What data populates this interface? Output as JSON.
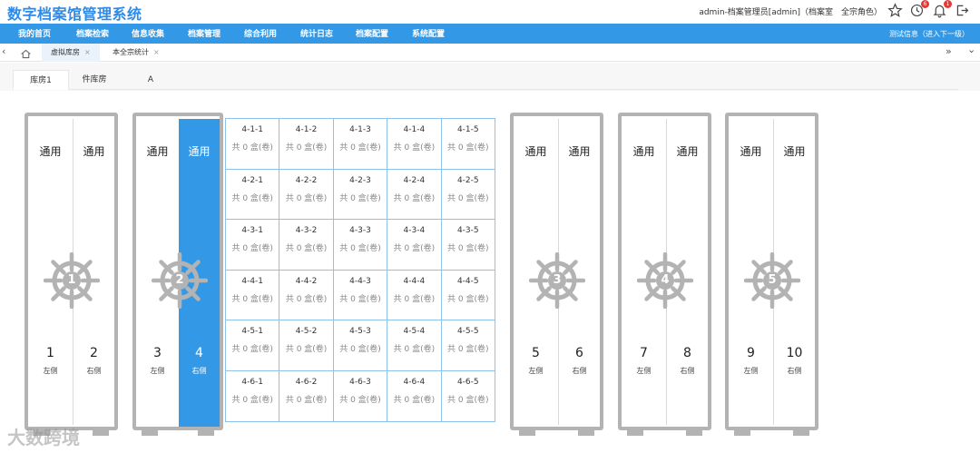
{
  "header": {
    "app_title": "数字档案馆管理系统",
    "user_info": "admin-档案管理员[admin]（档案室　全宗角色）",
    "notifications": [
      {
        "icon": "star-icon"
      },
      {
        "icon": "clock-icon",
        "badge": "6"
      },
      {
        "icon": "bell-icon",
        "badge": "1"
      },
      {
        "icon": "logout-icon"
      }
    ]
  },
  "nav": {
    "items": [
      "我的首页",
      "档案检索",
      "信息收集",
      "档案管理",
      "综合利用",
      "统计日志",
      "档案配置",
      "系统配置"
    ],
    "right_text": "测试信息（进入下一级）"
  },
  "page_tabs": [
    {
      "label": "虚拟库房",
      "active": true,
      "close": "×"
    },
    {
      "label": "本全宗统计",
      "active": false,
      "close": "×"
    }
  ],
  "tabbar_arrows": {
    "left": "‹",
    "right_double": "»",
    "right_down": "⌄"
  },
  "sub_tabs": [
    "库房1",
    "件库房",
    "A"
  ],
  "cabinets": [
    {
      "wheel": "1",
      "doors": [
        {
          "label": "通用",
          "num": "1",
          "side": "左侧"
        },
        {
          "label": "通用",
          "num": "2",
          "side": "右侧"
        }
      ]
    },
    {
      "wheel": "2",
      "doors": [
        {
          "label": "通用",
          "num": "3",
          "side": "左侧"
        },
        {
          "label": "通用",
          "num": "4",
          "side": "右侧",
          "active": true
        }
      ]
    },
    {
      "wheel": "3",
      "doors": [
        {
          "label": "通用",
          "num": "5",
          "side": "左侧"
        },
        {
          "label": "通用",
          "num": "6",
          "side": "右侧"
        }
      ]
    },
    {
      "wheel": "4",
      "doors": [
        {
          "label": "通用",
          "num": "7",
          "side": "左侧"
        },
        {
          "label": "通用",
          "num": "8",
          "side": "右侧"
        }
      ]
    },
    {
      "wheel": "5",
      "doors": [
        {
          "label": "通用",
          "num": "9",
          "side": "左侧"
        },
        {
          "label": "通用",
          "num": "10",
          "side": "右侧"
        }
      ]
    }
  ],
  "grid": {
    "count_text": "共 0 盒(卷)",
    "rows": [
      [
        "4-1-1",
        "4-1-2",
        "4-1-3",
        "4-1-4",
        "4-1-5"
      ],
      [
        "4-2-1",
        "4-2-2",
        "4-2-3",
        "4-2-4",
        "4-2-5"
      ],
      [
        "4-3-1",
        "4-3-2",
        "4-3-3",
        "4-3-4",
        "4-3-5"
      ],
      [
        "4-4-1",
        "4-4-2",
        "4-4-3",
        "4-4-4",
        "4-4-5"
      ],
      [
        "4-5-1",
        "4-5-2",
        "4-5-3",
        "4-5-4",
        "4-5-5"
      ],
      [
        "4-6-1",
        "4-6-2",
        "4-6-3",
        "4-6-4",
        "4-6-5"
      ]
    ]
  },
  "watermark": "大数跨境",
  "colors": {
    "accent": "#3399e6",
    "title": "#2d8ae8",
    "shelf": "#b3b3b3",
    "badge": "#e53935"
  }
}
